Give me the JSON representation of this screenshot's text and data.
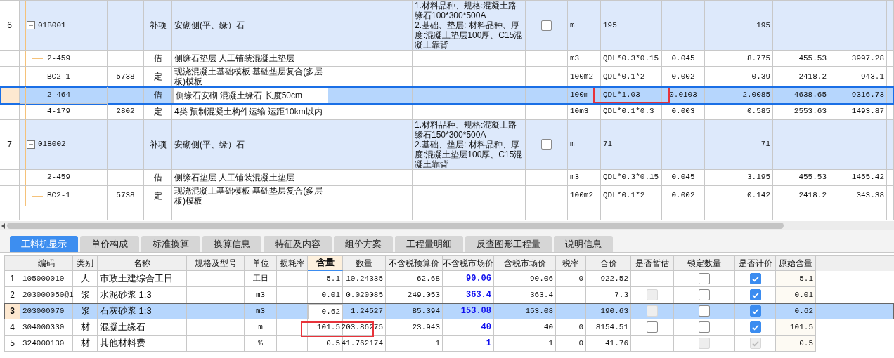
{
  "items": [
    {
      "number": "6",
      "code": "01B001",
      "expanded": true,
      "type": "补项",
      "name": "安砌侧(平、缘）石",
      "features": "1.材料品种、规格:混凝土路缘石100*300*500A\n2.基础、垫层: 材料品种、厚度:混凝土垫层100厚、C15混凝土靠背",
      "checked": false,
      "unit": "m",
      "expression": "195",
      "quantity": "195",
      "children": [
        {
          "code": "2-459",
          "type": "借",
          "name": "侧缘石垫层 人工铺装混凝土垫层",
          "unit": "m3",
          "expression": "QDL*0.3*0.15",
          "factor": "0.045",
          "quantity": "8.775",
          "price": "455.53",
          "total": "3997.28",
          "selected": false,
          "annotated": false
        },
        {
          "code": "BC2-1",
          "ref": "5738",
          "type": "定",
          "name": "现浇混凝土基础模板 基础垫层复合(多层板)模板",
          "unit": "100m2",
          "expression": "QDL*0.1*2",
          "factor": "0.002",
          "quantity": "0.39",
          "price": "2418.2",
          "total": "943.1",
          "selected": false,
          "annotated": false
        },
        {
          "code": "2-464",
          "type": "借",
          "name": "侧缘石安砌 混凝土缘石 长度50cm",
          "unit": "100m",
          "expression": "QDL*1.03",
          "factor": "0.0103",
          "quantity": "2.0085",
          "price": "4638.65",
          "total": "9316.73",
          "selected": true,
          "annotated": true
        },
        {
          "code": "4-179",
          "ref": "2802",
          "type": "定",
          "name": "4类 预制混凝土构件运输 运距10km以内",
          "unit": "10m3",
          "expression": "QDL*0.1*0.3",
          "factor": "0.003",
          "quantity": "0.585",
          "price": "2553.63",
          "total": "1493.87",
          "selected": false,
          "annotated": false
        }
      ]
    },
    {
      "number": "7",
      "code": "01B002",
      "expanded": true,
      "type": "补项",
      "name": "安砌侧(平、缘）石",
      "features": "1.材料品种、规格:混凝土路缘石150*300*500A\n2.基础、垫层: 材料品种、厚度:混凝土垫层100厚、C15混凝土靠背",
      "checked": false,
      "unit": "m",
      "expression": "71",
      "quantity": "71",
      "children": [
        {
          "code": "2-459",
          "type": "借",
          "name": "侧缘石垫层 人工铺装混凝土垫层",
          "unit": "m3",
          "expression": "QDL*0.3*0.15",
          "factor": "0.045",
          "quantity": "3.195",
          "price": "455.53",
          "total": "1455.42",
          "selected": false,
          "annotated": false
        },
        {
          "code": "BC2-1",
          "ref": "5738",
          "type": "定",
          "name": "现浇混凝土基础模板 基础垫层复合(多层板)模板",
          "unit": "100m2",
          "expression": "QDL*0.1*2",
          "factor": "0.002",
          "quantity": "0.142",
          "price": "2418.2",
          "total": "343.38",
          "selected": false,
          "annotated": false
        }
      ]
    }
  ],
  "tabs": [
    {
      "label": "工料机显示",
      "selected": true
    },
    {
      "label": "单价构成",
      "selected": false
    },
    {
      "label": "标准换算",
      "selected": false
    },
    {
      "label": "换算信息",
      "selected": false
    },
    {
      "label": "特征及内容",
      "selected": false
    },
    {
      "label": "组价方案",
      "selected": false
    },
    {
      "label": "工程量明细",
      "selected": false
    },
    {
      "label": "反查图形工程量",
      "selected": false
    },
    {
      "label": "说明信息",
      "selected": false
    }
  ],
  "columns": [
    {
      "label": "编码",
      "highlighted": false
    },
    {
      "label": "类别",
      "highlighted": false
    },
    {
      "label": "名称",
      "highlighted": false
    },
    {
      "label": "规格及型号",
      "highlighted": false
    },
    {
      "label": "单位",
      "highlighted": false
    },
    {
      "label": "损耗率",
      "highlighted": false
    },
    {
      "label": "含量",
      "highlighted": true
    },
    {
      "label": "数量",
      "highlighted": false
    },
    {
      "label": "不含税预算价",
      "highlighted": false
    },
    {
      "label": "不含税市场价",
      "highlighted": false
    },
    {
      "label": "含税市场价",
      "highlighted": false
    },
    {
      "label": "税率",
      "highlighted": false
    },
    {
      "label": "合价",
      "highlighted": false
    },
    {
      "label": "是否暂估",
      "highlighted": false
    },
    {
      "label": "锁定数量",
      "highlighted": false
    },
    {
      "label": "是否计价",
      "highlighted": false
    },
    {
      "label": "原始含量",
      "highlighted": false
    }
  ],
  "rows": [
    {
      "number": "1",
      "code": "105000010",
      "type": "人",
      "name": "市政土建综合工日",
      "unit": "工日",
      "content": "5.1",
      "quantity": "10.24335",
      "budget_price": "62.68",
      "market_price": "90.06",
      "market_price_tax": "90.06",
      "tax_rate": "0",
      "total": "922.52",
      "locked": {
        "checked": false,
        "disabled": false
      },
      "priced": {
        "checked": true,
        "disabled": false
      },
      "original_content": "5.1",
      "selected": false,
      "annotated": false
    },
    {
      "number": "2",
      "code": "203000050@1",
      "type": "浆",
      "name": "水泥砂浆 1:3",
      "unit": "m3",
      "content": "0.01",
      "quantity": "0.020085",
      "budget_price": "249.053",
      "market_price": "363.4",
      "market_price_tax": "363.4",
      "total": "7.3",
      "provisional": {
        "checked": false,
        "disabled": true
      },
      "locked": {
        "checked": false,
        "disabled": false
      },
      "priced": {
        "checked": true,
        "disabled": false
      },
      "original_content": "0.01",
      "selected": false,
      "annotated": false
    },
    {
      "number": "3",
      "code": "203000070",
      "type": "浆",
      "name": "石灰砂浆 1:3",
      "unit": "m3",
      "content": "0.62",
      "quantity": "1.24527",
      "budget_price": "85.394",
      "market_price": "153.08",
      "market_price_tax": "153.08",
      "total": "190.63",
      "provisional": {
        "checked": false,
        "disabled": true
      },
      "locked": {
        "checked": false,
        "disabled": false
      },
      "priced": {
        "checked": true,
        "disabled": false
      },
      "original_content": "0.62",
      "selected": true,
      "annotated": false
    },
    {
      "number": "4",
      "code": "304000330",
      "type": "材",
      "name": "混凝土缘石",
      "unit": "m",
      "content": "101.5",
      "quantity": "203.86275",
      "budget_price": "23.943",
      "market_price": "40",
      "market_price_tax": "40",
      "tax_rate": "0",
      "total": "8154.51",
      "provisional": {
        "checked": false,
        "disabled": false
      },
      "locked": {
        "checked": false,
        "disabled": false
      },
      "priced": {
        "checked": true,
        "disabled": false
      },
      "original_content": "101.5",
      "selected": false,
      "annotated": true
    },
    {
      "number": "5",
      "code": "324000130",
      "type": "材",
      "name": "其他材料费",
      "unit": "%",
      "content": "0.5",
      "quantity": "41.762174",
      "budget_price": "1",
      "market_price": "1",
      "market_price_tax": "1",
      "tax_rate": "0",
      "total": "41.76",
      "locked": {
        "checked": false,
        "disabled": true
      },
      "priced": {
        "checked": true,
        "disabled": true
      },
      "original_content": "0.5",
      "selected": false,
      "annotated": false
    }
  ]
}
